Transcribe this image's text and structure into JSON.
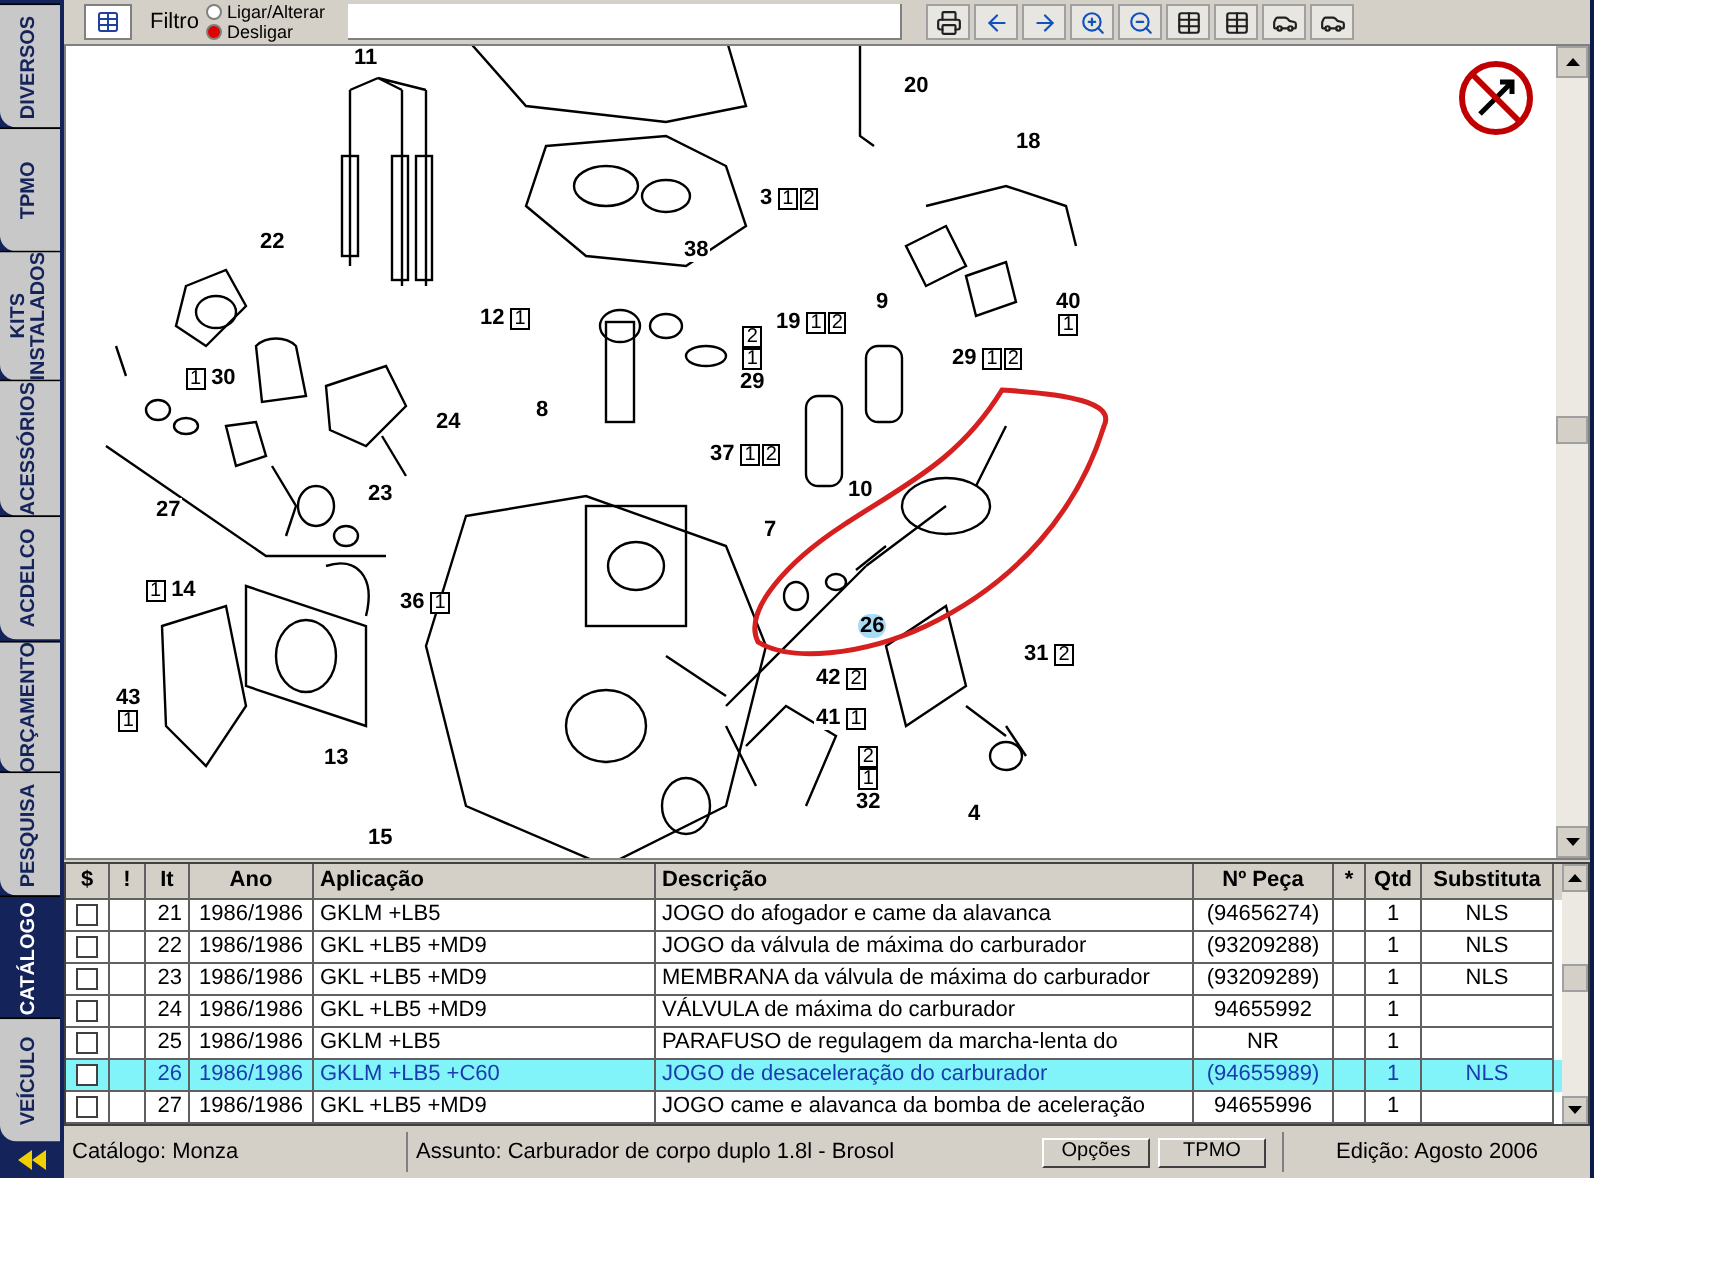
{
  "sidebar": {
    "tabs": [
      {
        "label": "DIVERSOS",
        "selected": false
      },
      {
        "label": "TPMO",
        "selected": false
      },
      {
        "label": "KITS INSTALADOS",
        "selected": false
      },
      {
        "label": "ACESSÓRIOS",
        "selected": false
      },
      {
        "label": "ACDELCO",
        "selected": false
      },
      {
        "label": "ORÇAMENTO",
        "selected": false
      },
      {
        "label": "PESQUISA",
        "selected": false
      },
      {
        "label": "CATÁLOGO",
        "selected": true
      },
      {
        "label": "VEÍCULO",
        "selected": false
      }
    ]
  },
  "toolbar": {
    "filter_label": "Filtro",
    "filter_options": [
      {
        "label": "Ligar/Alterar",
        "selected": false
      },
      {
        "label": "Desligar",
        "selected": true
      }
    ]
  },
  "diagram": {
    "callouts": [
      {
        "number": "11",
        "selected": false
      },
      {
        "number": "20",
        "selected": false
      },
      {
        "number": "3",
        "boxes_after": [
          "1",
          "2"
        ],
        "selected": false
      },
      {
        "number": "22",
        "selected": false
      },
      {
        "number": "18",
        "selected": false
      },
      {
        "number": "38",
        "selected": false
      },
      {
        "number": "12",
        "boxes_after": [
          "1"
        ],
        "selected": false
      },
      {
        "number": "19",
        "boxes_after": [
          "1",
          "2"
        ],
        "selected": false
      },
      {
        "number": "9",
        "selected": false
      },
      {
        "number": "40",
        "boxes_below": [
          "1"
        ],
        "selected": false
      },
      {
        "number": "29",
        "boxes_after": [
          "1",
          "2"
        ],
        "selected": false
      },
      {
        "number": "30",
        "boxes_before": [
          "1"
        ],
        "selected": false
      },
      {
        "number": "29",
        "boxes_above": [
          "2",
          "1"
        ],
        "selected": false
      },
      {
        "number": "24",
        "selected": false
      },
      {
        "number": "8",
        "selected": false
      },
      {
        "number": "37",
        "boxes_after": [
          "1",
          "2"
        ],
        "selected": false
      },
      {
        "number": "23",
        "selected": false
      },
      {
        "number": "10",
        "selected": false
      },
      {
        "number": "27",
        "selected": false
      },
      {
        "number": "7",
        "selected": false
      },
      {
        "number": "14",
        "boxes_before": [
          "1"
        ],
        "selected": false
      },
      {
        "number": "36",
        "boxes_after": [
          "1"
        ],
        "selected": false
      },
      {
        "number": "26",
        "selected": true
      },
      {
        "number": "31",
        "boxes_after": [
          "2"
        ],
        "selected": false
      },
      {
        "number": "42",
        "boxes_after": [
          "2"
        ],
        "selected": false
      },
      {
        "number": "41",
        "boxes_after": [
          "1"
        ],
        "selected": false
      },
      {
        "number": "43",
        "boxes_below": [
          "1"
        ],
        "selected": false
      },
      {
        "number": "13",
        "selected": false
      },
      {
        "number": "4",
        "selected": false
      },
      {
        "number": "32",
        "boxes_above": [
          "2",
          "1"
        ],
        "selected": false
      },
      {
        "number": "15",
        "selected": false
      }
    ]
  },
  "table": {
    "columns": [
      "$",
      "!",
      "It",
      "Ano",
      "Aplicação",
      "Descrição",
      "Nº Peça",
      "*",
      "Qtd",
      "Substituta"
    ],
    "rows": [
      {
        "checked": false,
        "selected": false,
        "item": "21",
        "year": "1986/1986",
        "application": "GKLM +LB5",
        "description": "JOGO do afogador e came da alavanca",
        "part_number": "(94656274)",
        "quantity": "1",
        "substitute": "NLS"
      },
      {
        "checked": false,
        "selected": false,
        "item": "22",
        "year": "1986/1986",
        "application": "GKL +LB5 +MD9",
        "description": "JOGO da válvula de máxima do carburador",
        "part_number": "(93209288)",
        "quantity": "1",
        "substitute": "NLS"
      },
      {
        "checked": false,
        "selected": false,
        "item": "23",
        "year": "1986/1986",
        "application": "GKL +LB5 +MD9",
        "description": "MEMBRANA da válvula de máxima do carburador",
        "part_number": "(93209289)",
        "quantity": "1",
        "substitute": "NLS"
      },
      {
        "checked": false,
        "selected": false,
        "item": "24",
        "year": "1986/1986",
        "application": "GKL +LB5 +MD9",
        "description": "VÁLVULA de máxima do carburador",
        "part_number": "94655992",
        "quantity": "1"
      },
      {
        "checked": false,
        "selected": false,
        "item": "25",
        "year": "1986/1986",
        "application": "GKLM +LB5",
        "description": "PARAFUSO de regulagem da marcha-lenta do",
        "part_number": "NR",
        "quantity": "1"
      },
      {
        "checked": false,
        "selected": true,
        "item": "26",
        "year": "1986/1986",
        "application": "GKLM +LB5 +C60",
        "description": "JOGO de desaceleração do carburador",
        "part_number": "(94655989)",
        "quantity": "1",
        "substitute": "NLS"
      },
      {
        "checked": false,
        "selected": false,
        "item": "27",
        "year": "1986/1986",
        "application": "GKL +LB5 +MD9",
        "description": "JOGO came e alavanca da bomba de aceleração",
        "part_number": "94655996",
        "quantity": "1"
      }
    ]
  },
  "status_bar": {
    "catalog": "Catálogo: Monza",
    "subject": "Assunto: Carburador de corpo duplo 1.8l - Brosol",
    "buttons": [
      "Opções",
      "TPMO"
    ],
    "edition": "Edição: Agosto 2006"
  }
}
